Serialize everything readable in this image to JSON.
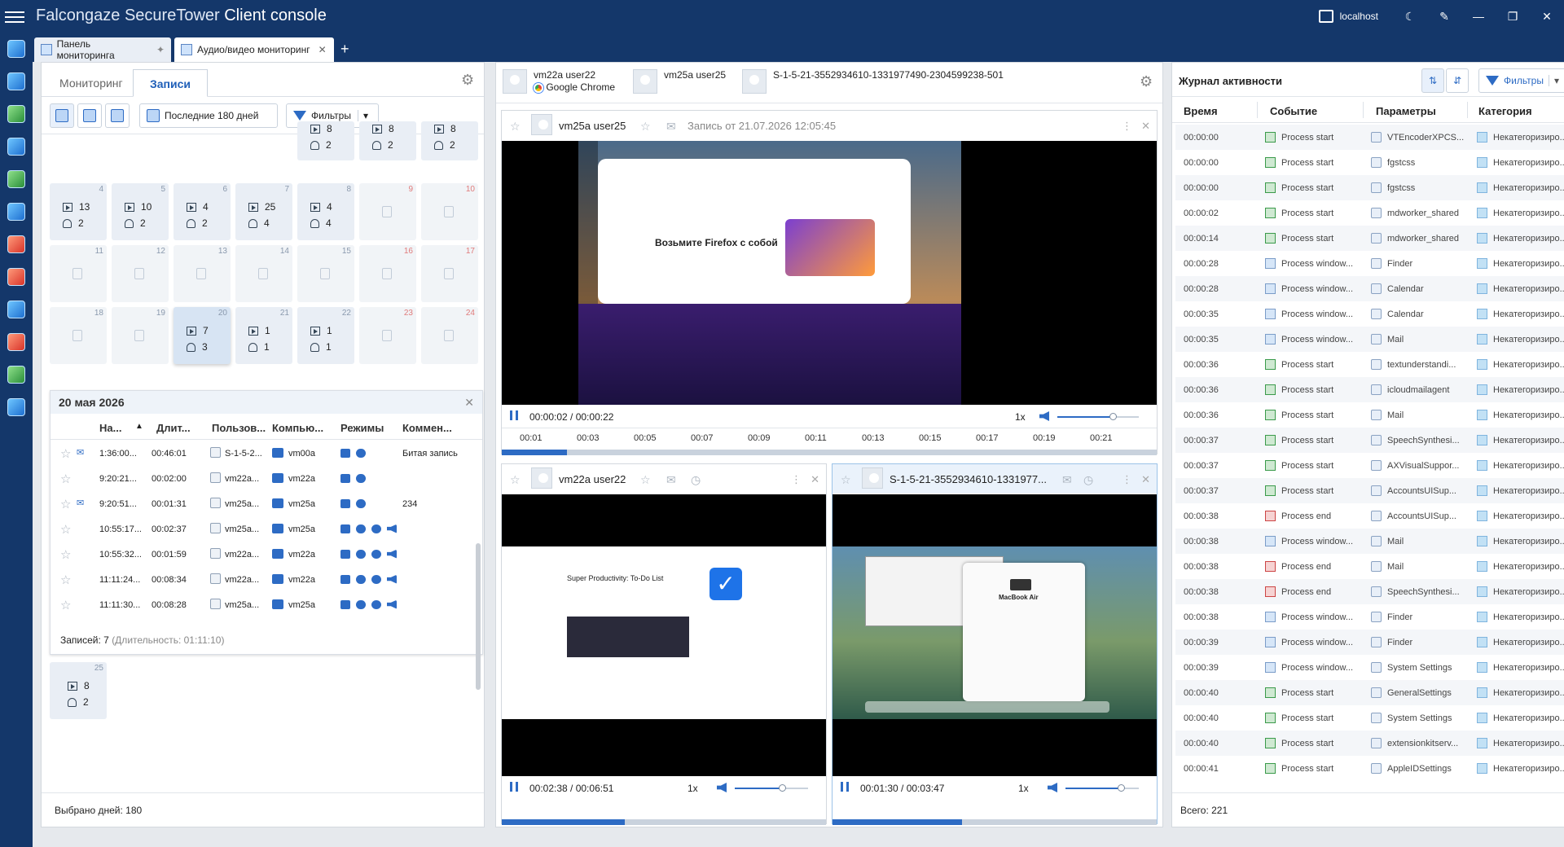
{
  "app": {
    "title_pre": "Falcongaze SecureTower ",
    "title_main": "Client console",
    "host": "localhost"
  },
  "tabs": [
    {
      "label": "Панель мониторинга"
    },
    {
      "label": "Аудио/видео мониторинг"
    }
  ],
  "left": {
    "tab_monitoring": "Мониторинг",
    "tab_records": "Записи",
    "period": "Последние 180 дней",
    "filters": "Фильтры",
    "calendar": [
      {
        "day": "",
        "v": "8",
        "u": "2"
      },
      {
        "day": "",
        "v": "8",
        "u": "2"
      },
      {
        "day": "",
        "v": "8",
        "u": "2"
      },
      {
        "day": "4",
        "v": "13",
        "u": "2"
      },
      {
        "day": "5",
        "v": "10",
        "u": "2"
      },
      {
        "day": "6",
        "v": "4",
        "u": "2"
      },
      {
        "day": "7",
        "v": "25",
        "u": "4"
      },
      {
        "day": "8",
        "v": "4",
        "u": "4"
      },
      {
        "day": "9"
      },
      {
        "day": "10"
      },
      {
        "day": "11"
      },
      {
        "day": "12"
      },
      {
        "day": "13"
      },
      {
        "day": "14"
      },
      {
        "day": "15"
      },
      {
        "day": "16"
      },
      {
        "day": "17"
      },
      {
        "day": "18"
      },
      {
        "day": "19"
      },
      {
        "day": "20",
        "v": "7",
        "u": "3"
      },
      {
        "day": "21",
        "v": "1",
        "u": "1"
      },
      {
        "day": "22",
        "v": "1",
        "u": "1"
      },
      {
        "day": "23"
      },
      {
        "day": "24"
      }
    ],
    "detail": {
      "date": "20 мая 2026",
      "columns": [
        "На...",
        "Длит...",
        "Пользов...",
        "Компью...",
        "Режимы",
        "Коммен..."
      ],
      "rows": [
        {
          "start": "1:36:00...",
          "dur": "00:46:01",
          "user": "S-1-5-2...",
          "pc": "vm00a",
          "comment": "Битая запись"
        },
        {
          "start": "9:20:21...",
          "dur": "00:02:00",
          "user": "vm22a...",
          "pc": "vm22a",
          "comment": ""
        },
        {
          "start": "9:20:51...",
          "dur": "00:01:31",
          "user": "vm25a...",
          "pc": "vm25a",
          "comment": "234"
        },
        {
          "start": "10:55:17...",
          "dur": "00:02:37",
          "user": "vm25a...",
          "pc": "vm25a",
          "comment": ""
        },
        {
          "start": "10:55:32...",
          "dur": "00:01:59",
          "user": "vm22a...",
          "pc": "vm22a",
          "comment": ""
        },
        {
          "start": "11:11:24...",
          "dur": "00:08:34",
          "user": "vm22a...",
          "pc": "vm22a",
          "comment": ""
        },
        {
          "start": "11:11:30...",
          "dur": "00:08:28",
          "user": "vm25a...",
          "pc": "vm25a",
          "comment": ""
        }
      ],
      "footer_label": "Записей: 7",
      "footer_dur": "(Длительность: 01:11:10)"
    },
    "day25": {
      "day": "25",
      "v": "8",
      "u": "2"
    },
    "selected_days": "Выбрано дней: 180"
  },
  "middle": {
    "header_users": [
      {
        "name": "vm22a user22",
        "app": "Google Chrome"
      },
      {
        "name": "vm25a user25"
      },
      {
        "name": "S-1-5-21-3552934610-1331977490-2304599238-501"
      }
    ],
    "main_player": {
      "user": "vm25a user25",
      "title": "Запись от 21.07.2026 12:05:45",
      "time": "00:00:02 / 00:00:22",
      "speed": "1x",
      "ticks": [
        "00:01",
        "00:03",
        "00:05",
        "00:07",
        "00:09",
        "00:11",
        "00:13",
        "00:15",
        "00:17",
        "00:19",
        "00:21"
      ],
      "progress": 0.1
    },
    "player2": {
      "user": "vm22a user22",
      "time": "00:02:38 / 00:06:51",
      "speed": "1x",
      "progress": 0.38
    },
    "player3": {
      "user": "S-1-5-21-3552934610-1331977...",
      "time": "00:01:30 / 00:03:47",
      "speed": "1x",
      "progress": 0.4
    },
    "screen1": {
      "heading": "Возьмите Firefox с собой"
    },
    "screen2": {
      "heading": "Super Productivity: To-Do List"
    },
    "screen3": {
      "heading": "MacBook Air"
    }
  },
  "right": {
    "title": "Журнал активности",
    "filters": "Фильтры",
    "columns": [
      "Время",
      "Событие",
      "Параметры",
      "Категория"
    ],
    "rows": [
      {
        "t": "00:00:00",
        "e": "Process start",
        "p": "VTEncoderXPCS...",
        "c": "Некатегоризиро...",
        "k": "start"
      },
      {
        "t": "00:00:00",
        "e": "Process start",
        "p": "fgstcss",
        "c": "Некатегоризиро...",
        "k": "start"
      },
      {
        "t": "00:00:00",
        "e": "Process start",
        "p": "fgstcss",
        "c": "Некатегоризиро...",
        "k": "start"
      },
      {
        "t": "00:00:02",
        "e": "Process start",
        "p": "mdworker_shared",
        "c": "Некатегоризиро...",
        "k": "start"
      },
      {
        "t": "00:00:14",
        "e": "Process start",
        "p": "mdworker_shared",
        "c": "Некатегоризиро...",
        "k": "start"
      },
      {
        "t": "00:00:28",
        "e": "Process window...",
        "p": "Finder",
        "c": "Некатегоризиро...",
        "k": "win"
      },
      {
        "t": "00:00:28",
        "e": "Process window...",
        "p": "Calendar",
        "c": "Некатегоризиро...",
        "k": "win"
      },
      {
        "t": "00:00:35",
        "e": "Process window...",
        "p": "Calendar",
        "c": "Некатегоризиро...",
        "k": "win"
      },
      {
        "t": "00:00:35",
        "e": "Process window...",
        "p": "Mail",
        "c": "Некатегоризиро...",
        "k": "win"
      },
      {
        "t": "00:00:36",
        "e": "Process start",
        "p": "textunderstandi...",
        "c": "Некатегоризиро...",
        "k": "start"
      },
      {
        "t": "00:00:36",
        "e": "Process start",
        "p": "icloudmailagent",
        "c": "Некатегоризиро...",
        "k": "start"
      },
      {
        "t": "00:00:36",
        "e": "Process start",
        "p": "Mail",
        "c": "Некатегоризиро...",
        "k": "start"
      },
      {
        "t": "00:00:37",
        "e": "Process start",
        "p": "SpeechSynthesi...",
        "c": "Некатегоризиро...",
        "k": "start"
      },
      {
        "t": "00:00:37",
        "e": "Process start",
        "p": "AXVisualSuppor...",
        "c": "Некатегоризиро...",
        "k": "start"
      },
      {
        "t": "00:00:37",
        "e": "Process start",
        "p": "AccountsUISup...",
        "c": "Некатегоризиро...",
        "k": "start"
      },
      {
        "t": "00:00:38",
        "e": "Process end",
        "p": "AccountsUISup...",
        "c": "Некатегоризиро...",
        "k": "end"
      },
      {
        "t": "00:00:38",
        "e": "Process window...",
        "p": "Mail",
        "c": "Некатегоризиро...",
        "k": "win"
      },
      {
        "t": "00:00:38",
        "e": "Process end",
        "p": "Mail",
        "c": "Некатегоризиро...",
        "k": "end"
      },
      {
        "t": "00:00:38",
        "e": "Process end",
        "p": "SpeechSynthesi...",
        "c": "Некатегоризиро...",
        "k": "end"
      },
      {
        "t": "00:00:38",
        "e": "Process window...",
        "p": "Finder",
        "c": "Некатегоризиро...",
        "k": "win"
      },
      {
        "t": "00:00:39",
        "e": "Process window...",
        "p": "Finder",
        "c": "Некатегоризиро...",
        "k": "win"
      },
      {
        "t": "00:00:39",
        "e": "Process window...",
        "p": "System Settings",
        "c": "Некатегоризиро...",
        "k": "win"
      },
      {
        "t": "00:00:40",
        "e": "Process start",
        "p": "GeneralSettings",
        "c": "Некатегоризиро...",
        "k": "start"
      },
      {
        "t": "00:00:40",
        "e": "Process start",
        "p": "System Settings",
        "c": "Некатегоризиро...",
        "k": "start"
      },
      {
        "t": "00:00:40",
        "e": "Process start",
        "p": "extensionkitserv...",
        "c": "Некатегоризиро...",
        "k": "start"
      },
      {
        "t": "00:00:41",
        "e": "Process start",
        "p": "AppleIDSettings",
        "c": "Некатегоризиро...",
        "k": "start"
      }
    ],
    "total": "Всего: 221"
  }
}
